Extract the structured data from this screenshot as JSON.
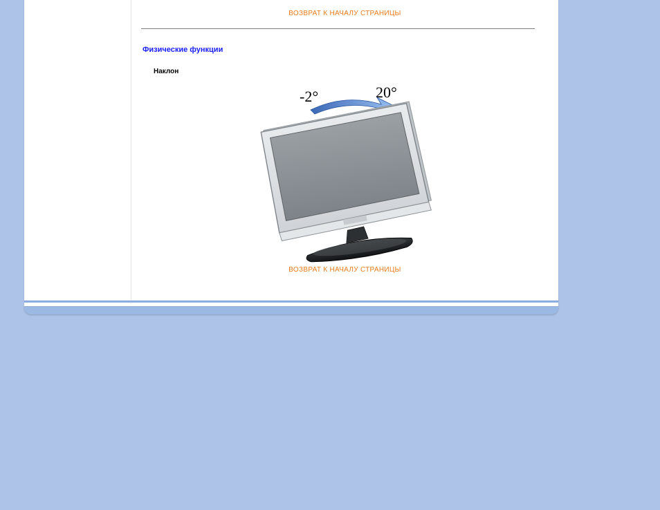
{
  "links": {
    "back_to_top_1": "ВОЗВРАТ К НАЧАЛУ СТРАНИЦЫ",
    "back_to_top_2": "ВОЗВРАТ К НАЧАЛУ СТРАНИЦЫ"
  },
  "section": {
    "heading": "Физические функции",
    "subheading": "Наклон"
  },
  "tilt": {
    "min_label": "-2°",
    "max_label": "20°"
  }
}
